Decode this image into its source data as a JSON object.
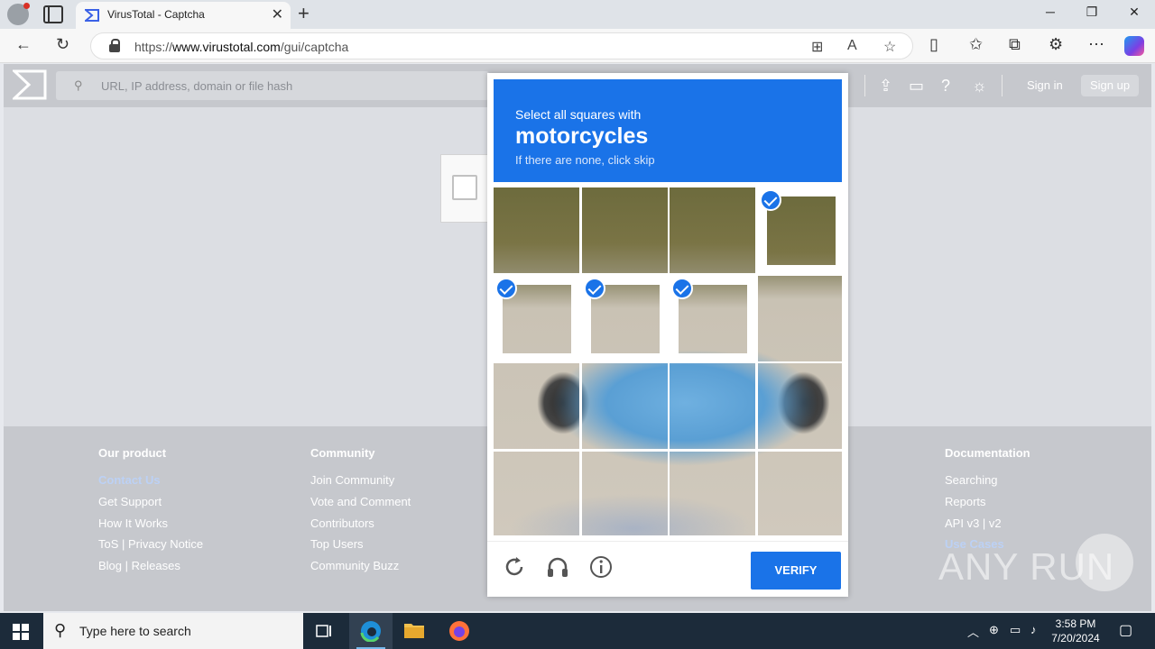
{
  "browser": {
    "tab_title": "VirusTotal - Captcha",
    "url_prefix": "https://",
    "url_domain": "www.virustotal.com",
    "url_path": "/gui/captcha",
    "window_controls": [
      "─",
      "❐",
      "✕"
    ]
  },
  "vt": {
    "search_placeholder": "URL, IP address, domain or file hash",
    "sign_in": "Sign in",
    "sign_up": "Sign up"
  },
  "footer": {
    "columns": [
      {
        "heading": "Our product",
        "links": [
          "Contact Us",
          "Get Support",
          "How It Works",
          "ToS | Privacy Notice",
          "Blog | Releases"
        ]
      },
      {
        "heading": "Community",
        "links": [
          "Join Community",
          "Vote and Comment",
          "Contributors",
          "Top Users",
          "Community Buzz"
        ]
      },
      {
        "heading": "Documentation",
        "links": [
          "Searching",
          "Reports",
          "API v3 | v2",
          "Use Cases"
        ]
      }
    ]
  },
  "captcha": {
    "prompt_line1": "Select all squares with",
    "prompt_target": "motorcycles",
    "prompt_hint": "If there are none, click skip",
    "verify_label": "VERIFY",
    "selected_tiles": [
      3,
      4,
      5,
      6
    ],
    "accent_color": "#1a73e8"
  },
  "watermark": "ANY RUN",
  "taskbar": {
    "search_placeholder": "Type here to search",
    "time": "3:58 PM",
    "date": "7/20/2024"
  }
}
